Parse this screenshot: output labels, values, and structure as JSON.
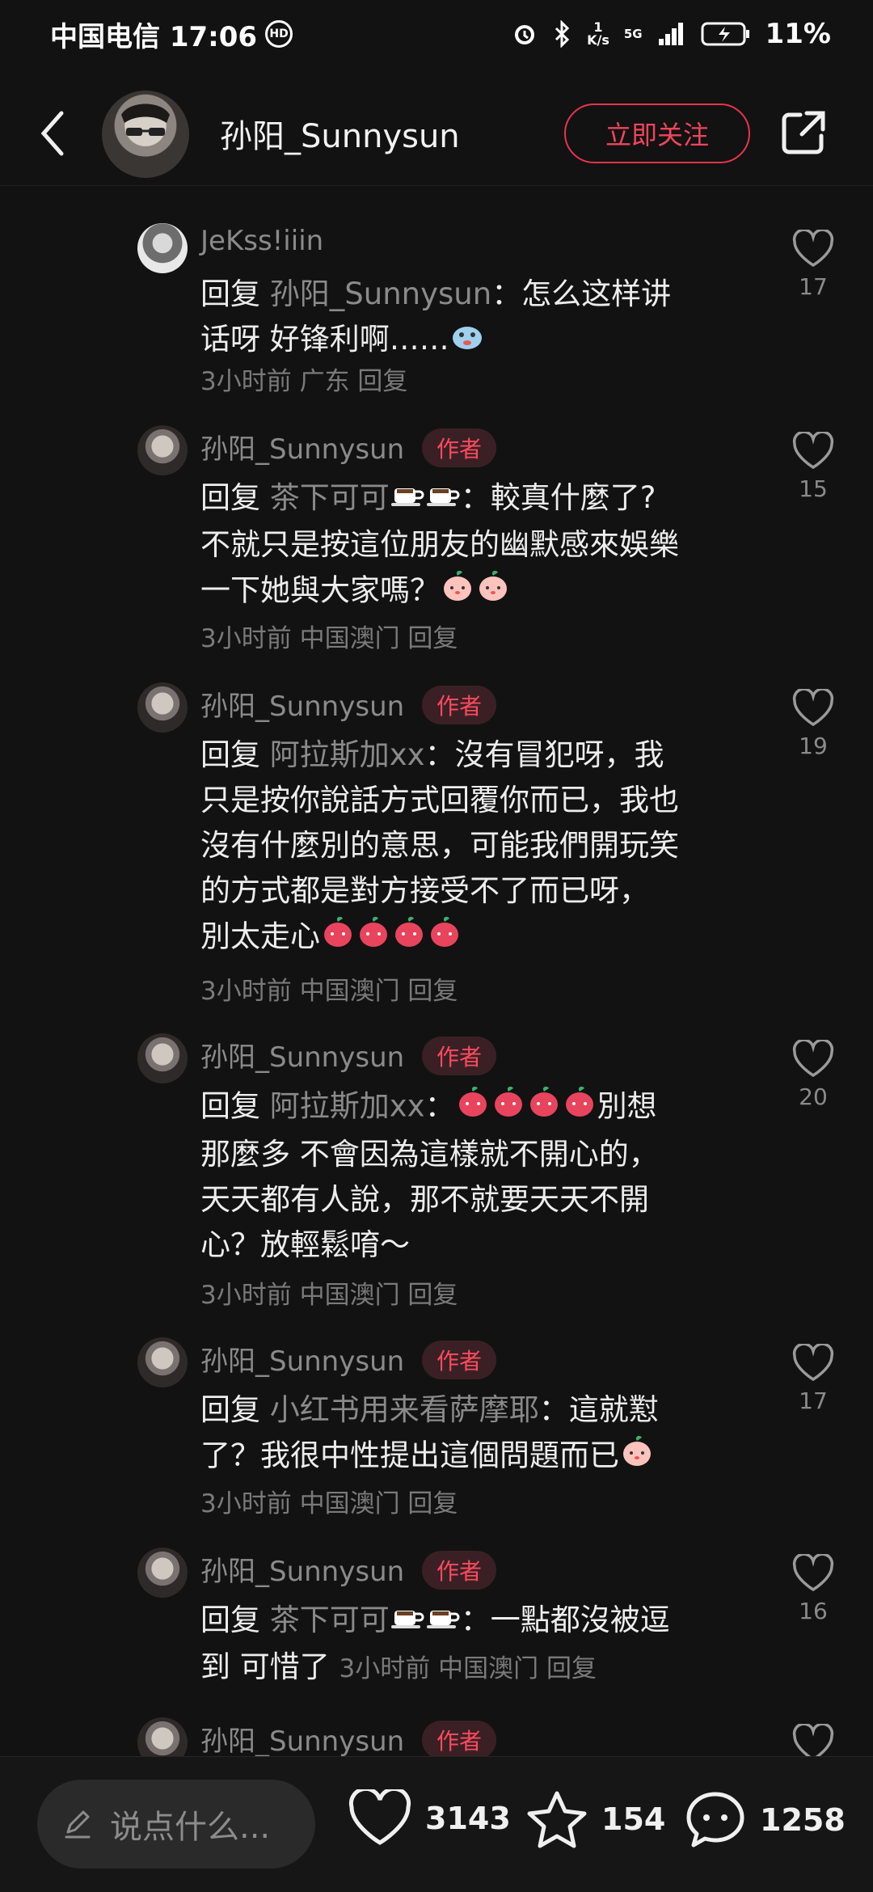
{
  "status_bar": {
    "carrier_time": "中国电信 17:06",
    "hd_label": "HD",
    "speed_value": "1",
    "speed_unit": "K/s",
    "net_label": "5G",
    "battery": "11%"
  },
  "header": {
    "name": "孙阳_Sunnysun",
    "follow_label": "立即关注"
  },
  "reply_word": "回复",
  "author_badge": "作者",
  "comments": [
    {
      "name": "JeKss!iiin",
      "target": "孙阳_Sunnysun",
      "line1": "：怎么这样讲",
      "line2": "话呀 好锋利啊……",
      "meta": "3小时前  广东  回复",
      "likes": "17"
    },
    {
      "name": "孙阳_Sunnysun",
      "target": "茶下可可",
      "line1": "：較真什麼了?",
      "line2": "不就只是按這位朋友的幽默感來娛樂",
      "line3": "一下她與大家嗎？",
      "meta": "3小时前  中国澳门  回复",
      "likes": "15"
    },
    {
      "name": "孙阳_Sunnysun",
      "target": "阿拉斯加xx",
      "line1": "：沒有冒犯呀，我",
      "line2": "只是按你說話方式回覆你而已，我也",
      "line3": "沒有什麼別的意思，可能我們開玩笑",
      "line4": "的方式都是對方接受不了而已呀，",
      "line5": "別太走心",
      "meta": "3小时前  中国澳门  回复",
      "likes": "19"
    },
    {
      "name": "孙阳_Sunnysun",
      "target": "阿拉斯加xx",
      "line1": "：",
      "line1b": "別想",
      "line2": "那麼多 不會因為這樣就不開心的，",
      "line3": "天天都有人說，那不就要天天不開",
      "line4": "心？放輕鬆唷～",
      "meta": "3小时前  中国澳门  回复",
      "likes": "20"
    },
    {
      "name": "孙阳_Sunnysun",
      "target": "小红书用来看萨摩耶",
      "line1": "：這就懟",
      "line2": "了？我很中性提出這個問題而已",
      "meta": "3小时前  中国澳门  回复",
      "likes": "17"
    },
    {
      "name": "孙阳_Sunnysun",
      "target": "茶下可可",
      "line1": "：一點都沒被逗",
      "line2": "到 可惜了",
      "meta": "3小时前  中国澳门  回复",
      "likes": "16"
    },
    {
      "name": "孙阳_Sunnysun"
    }
  ],
  "bottom": {
    "placeholder": "说点什么...",
    "likes": "3143",
    "stars": "154",
    "comments": "1258"
  },
  "colors": {
    "accent": "#f0455c",
    "background": "#121212",
    "muted": "#8a8a8a"
  },
  "icons": [
    "back-icon",
    "share-icon",
    "heart-icon",
    "star-icon",
    "chat-icon",
    "pencil-icon",
    "coffee-emoji",
    "peach-emoji",
    "scared-emoji"
  ]
}
